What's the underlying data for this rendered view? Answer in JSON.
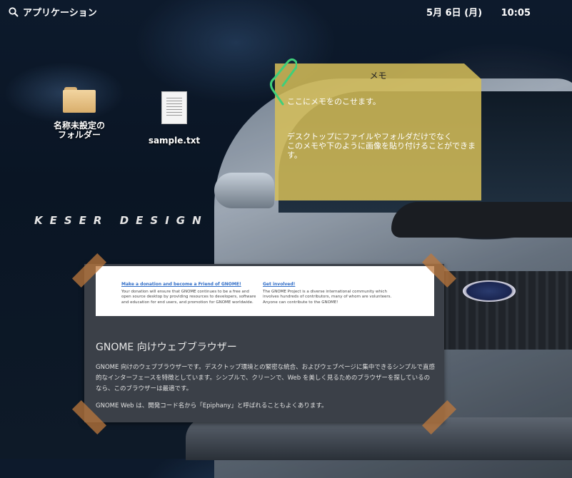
{
  "topbar": {
    "apps_label": "アプリケーション",
    "date": "5月 6日 (月)",
    "time": "10:05"
  },
  "desktop": {
    "folder_label": "名称未設定の\nフォルダー",
    "file_label": "sample.txt",
    "logo_text": "KESER DESIGN"
  },
  "memo": {
    "title": "メモ",
    "line1": "ここにメモをのこせます。",
    "line2": "デスクトップにファイルやフォルダだけでなく\nこのメモや下のように画像を貼り付けることができます。"
  },
  "card": {
    "shot_left_heading": "Make a donation and become a Friend of GNOME!",
    "shot_left_text": "Your donation will ensure that GNOME continues to be a free and open source desktop by providing resources to developers, software and education for end users, and promotion for GNOME worldwide.",
    "shot_right_heading": "Get involved!",
    "shot_right_text": "The GNOME Project is a diverse international community which involves hundreds of contributors, many of whom are volunteers. Anyone can contribute to the GNOME!",
    "title": "GNOME 向けウェブブラウザー",
    "para1": "GNOME 向けのウェブブラウザーです。デスクトップ環境との緊密な統合、およびウェブページに集中できるシンプルで直感的なインターフェースを特徴としています。シンプルで、クリーンで、Web を美しく見るためのブラウザーを探しているのなら、このブラウザーは最適です。",
    "para2": "GNOME Web は、開発コード名から「Epiphany」と呼ばれることもよくあります。"
  }
}
